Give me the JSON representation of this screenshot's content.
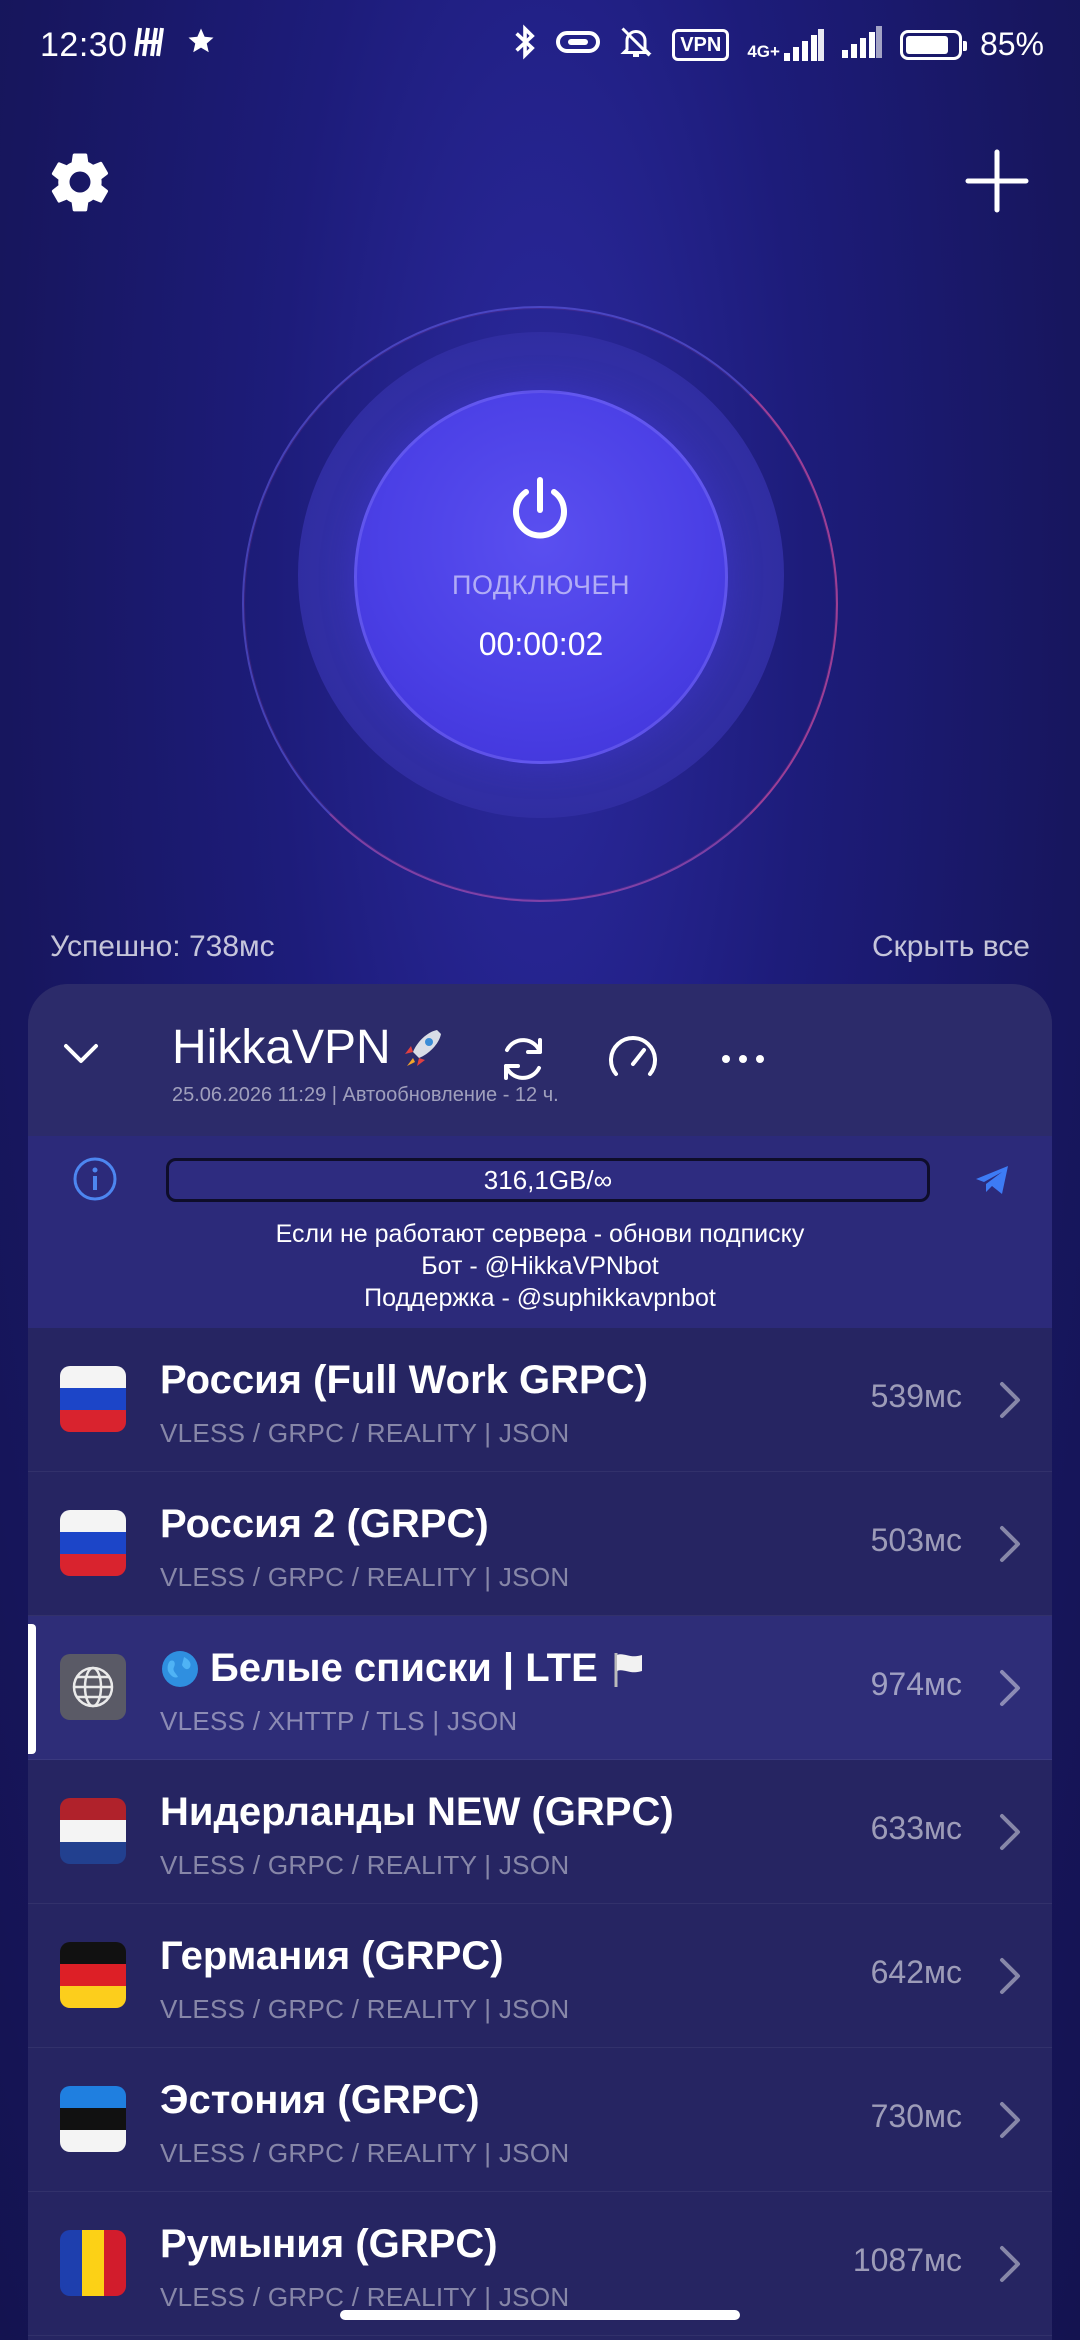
{
  "status_bar": {
    "time": "12:30",
    "left_icons": [
      "h-app-icon",
      "star-icon"
    ],
    "vpn_label": "VPN",
    "network_label": "4G+",
    "battery": "85%"
  },
  "power": {
    "status": "ПОДКЛЮЧЕН",
    "timer": "00:00:02"
  },
  "result": {
    "ping_text": "Успешно: 738мс",
    "hide_all": "Скрыть все"
  },
  "subscription": {
    "name": "HikkaVPN",
    "meta": "25.06.2026 11:29 | Автообновление - 12 ч.",
    "traffic": "316,1GB/∞",
    "info_lines": [
      "Если не работают сервера - обнови подписку",
      "Бот - @HikkaVPNbot",
      "Поддержка - @suphikkavpnbot"
    ]
  },
  "servers": [
    {
      "name": "Россия (Full Work GRPC)",
      "proto": "VLESS / GRPC / REALITY | JSON",
      "ping": "539мс",
      "flag": "ru"
    },
    {
      "name": "Россия 2 (GRPC)",
      "proto": "VLESS / GRPC / REALITY | JSON",
      "ping": "503мс",
      "flag": "ru"
    },
    {
      "name": "Белые списки | LTE",
      "proto": "VLESS / XHTTP / TLS | JSON",
      "ping": "974мс",
      "flag": "globe",
      "active": true
    },
    {
      "name": "Нидерланды NEW (GRPC)",
      "proto": "VLESS / GRPC / REALITY | JSON",
      "ping": "633мс",
      "flag": "nl"
    },
    {
      "name": "Германия (GRPC)",
      "proto": "VLESS / GRPC / REALITY | JSON",
      "ping": "642мс",
      "flag": "de"
    },
    {
      "name": "Эстония (GRPC)",
      "proto": "VLESS / GRPC / REALITY | JSON",
      "ping": "730мс",
      "flag": "ee"
    },
    {
      "name": "Румыния (GRPC)",
      "proto": "VLESS / GRPC / REALITY | JSON",
      "ping": "1087мс",
      "flag": "ro"
    }
  ],
  "colors": {
    "background": "#1d1c7a",
    "card": "#262562",
    "power_button": "#4b40e6",
    "accent_telegram": "#3d7bf5"
  }
}
